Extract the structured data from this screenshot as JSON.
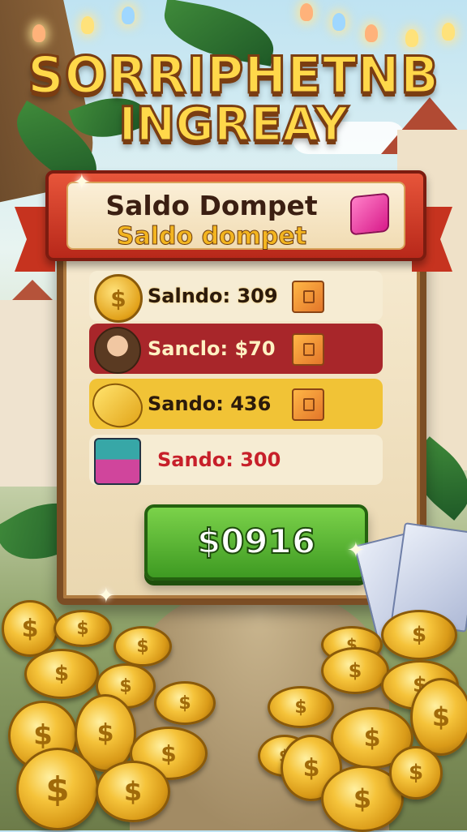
{
  "title": {
    "line1": "SORRIPHETNB",
    "line2": "INGREAY"
  },
  "panel": {
    "header_title": "Saldo Dompet",
    "header_subtitle": "Saldo dompet"
  },
  "rows": [
    {
      "label": "Salndo: 309",
      "icon": "coin-icon"
    },
    {
      "label": "Sanclo: $70",
      "icon": "avatar-icon"
    },
    {
      "label": "Sando: 436",
      "icon": "banana-icon"
    },
    {
      "label": "Sando: 300",
      "icon": "gift-stack-icon"
    }
  ],
  "balance_button": {
    "label": "$0916"
  },
  "colors": {
    "header_red": "#c6331f",
    "row_highlight_red": "#a8262a",
    "row_highlight_yellow": "#f1c336",
    "button_green": "#4caf2a",
    "title_gold": "#ffd84a"
  }
}
